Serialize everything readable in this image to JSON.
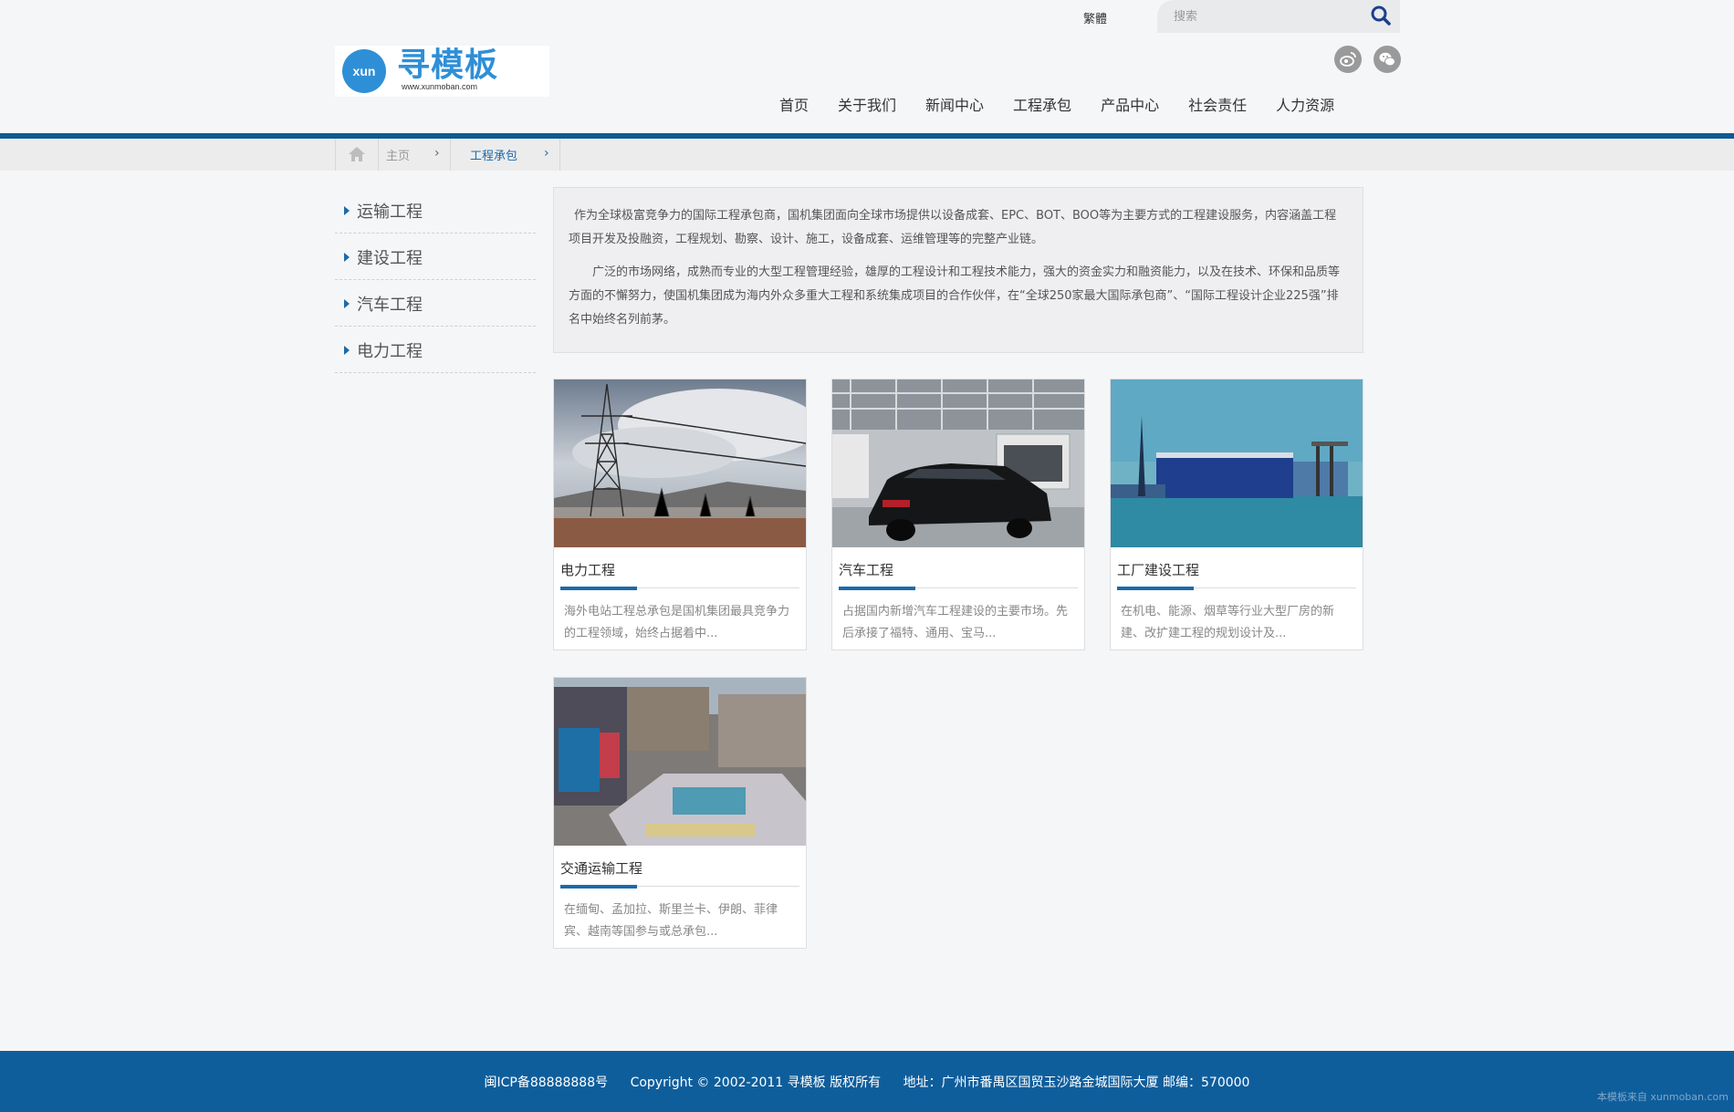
{
  "header": {
    "logo_mark": "xun",
    "logo_text": "寻模板",
    "logo_url": "www.xunmoban.com",
    "lang_switch": "繁體",
    "search_placeholder": "搜索"
  },
  "nav": {
    "items": [
      "首页",
      "关于我们",
      "新闻中心",
      "工程承包",
      "产品中心",
      "社会责任",
      "人力资源"
    ]
  },
  "breadcrumb": {
    "home": "主页",
    "current": "工程承包"
  },
  "sidebar": {
    "items": [
      "运输工程",
      "建设工程",
      "汽车工程",
      "电力工程"
    ]
  },
  "intro": {
    "p1": "作为全球极富竞争力的国际工程承包商，国机集团面向全球市场提供以设备成套、EPC、BOT、BOO等为主要方式的工程建设服务，内容涵盖工程项目开发及投融资，工程规划、勘察、设计、施工，设备成套、运维管理等的完整产业链。",
    "p2": "广泛的市场网络，成熟而专业的大型工程管理经验，雄厚的工程设计和工程技术能力，强大的资金实力和融资能力，以及在技术、环保和品质等方面的不懈努力，使国机集团成为海内外众多重大工程和系统集成项目的合作伙伴，在“全球250家最大国际承包商”、“国际工程设计企业225强”排名中始终名列前茅。"
  },
  "cards": [
    {
      "title": "电力工程",
      "desc": "海外电站工程总承包是国机集团最具竞争力的工程领域，始终占据着中..."
    },
    {
      "title": "汽车工程",
      "desc": "占据国内新增汽车工程建设的主要市场。先后承接了福特、通用、宝马..."
    },
    {
      "title": "工厂建设工程",
      "desc": "在机电、能源、烟草等行业大型厂房的新建、改扩建工程的规划设计及..."
    },
    {
      "title": "交通运输工程",
      "desc": "在缅甸、孟加拉、斯里兰卡、伊朗、菲律宾、越南等国参与或总承包..."
    }
  ],
  "footer": {
    "icp": "闽ICP备88888888号",
    "copyright": "Copyright © 2002-2011 寻模板 版权所有",
    "address": "地址：广州市番禺区国贸玉沙路金城国际大厦 邮编：570000",
    "watermark": "本模板来自 xunmoban.com"
  },
  "colors": {
    "brand_blue": "#0f5e9c",
    "accent_blue": "#1c6aa8",
    "logo_blue": "#2f8fd6"
  }
}
